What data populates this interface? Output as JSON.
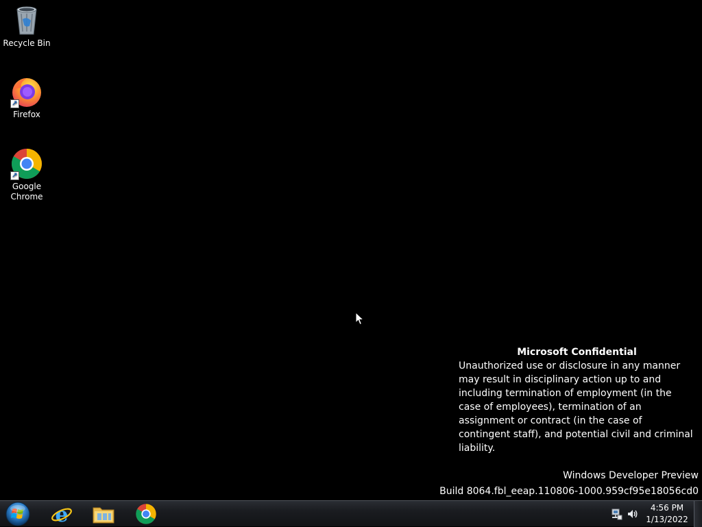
{
  "desktop": {
    "icons": [
      {
        "label": "Recycle Bin",
        "icon": "recycle-bin-icon"
      },
      {
        "label": "Firefox",
        "icon": "firefox-icon"
      },
      {
        "label_line1": "Google",
        "label_line2": "Chrome",
        "icon": "chrome-icon"
      }
    ],
    "background_color": "#000000"
  },
  "confidential": {
    "title": "Microsoft Confidential",
    "body": "Unauthorized use or disclosure in any manner may result in disciplinary action up to and including termination of employment (in the case of employees), termination of an assignment or contract (in the case of contingent staff), and potential civil and criminal liability."
  },
  "watermark": {
    "line1": "Windows Developer Preview",
    "line2": "Build 8064.fbl_eeap.110806-1000.959cf95e18056cd0"
  },
  "taskbar": {
    "start_icon": "windows-start-orb-icon",
    "pinned": [
      {
        "icon": "internet-explorer-icon"
      },
      {
        "icon": "file-explorer-icon"
      },
      {
        "icon": "chrome-icon"
      }
    ],
    "tray_icons": [
      "network-icon",
      "volume-icon"
    ],
    "clock": {
      "time": "4:56 PM",
      "date": "1/13/2022"
    }
  }
}
